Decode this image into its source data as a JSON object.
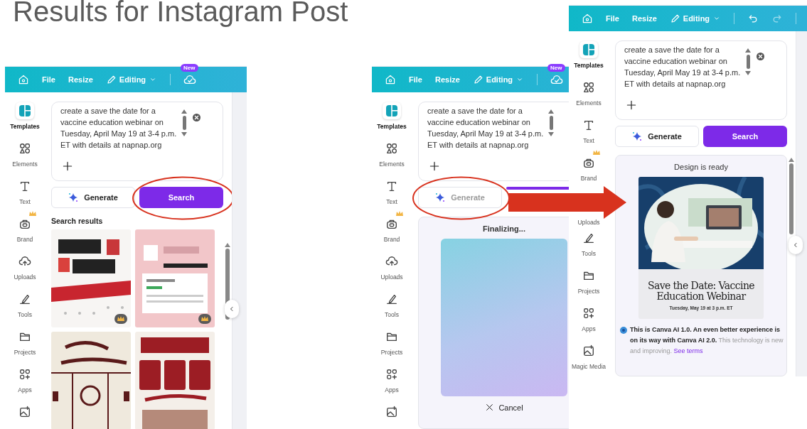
{
  "slide_title": "Results for Instagram Post",
  "panels": [
    {
      "kind": "search_results",
      "menu": {
        "file": "File",
        "resize": "Resize",
        "editing": "Editing"
      },
      "new_badge": "New",
      "sidebar": [
        {
          "label": "Templates",
          "selected": true
        },
        {
          "label": "Elements",
          "selected": false
        },
        {
          "label": "Text",
          "selected": false
        },
        {
          "label": "Brand",
          "selected": false
        },
        {
          "label": "Uploads",
          "selected": false
        },
        {
          "label": "Tools",
          "selected": false
        },
        {
          "label": "Projects",
          "selected": false
        },
        {
          "label": "Apps",
          "selected": false
        },
        {
          "selected": false
        }
      ],
      "prompt": "create a save the date for a vaccine education webinar on Tuesday, April May 19 at 3-4 p.m. ET with details at napnap.org",
      "generate": {
        "label": "Generate",
        "disabled": false
      },
      "search": {
        "label": "Search",
        "highlighted": true
      },
      "results_heading": "Search results"
    },
    {
      "kind": "generating",
      "menu": {
        "file": "File",
        "resize": "Resize",
        "editing": "Editing"
      },
      "new_badge": "New",
      "sidebar": [
        {
          "label": "Templates",
          "selected": true
        },
        {
          "label": "Elements",
          "selected": false
        },
        {
          "label": "Text",
          "selected": false
        },
        {
          "label": "Brand",
          "selected": false
        },
        {
          "label": "Uploads",
          "selected": false
        },
        {
          "label": "Tools",
          "selected": false
        },
        {
          "label": "Projects",
          "selected": false
        },
        {
          "label": "Apps",
          "selected": false
        },
        {
          "selected": false
        }
      ],
      "prompt": "create a save the date for a vaccine education webinar on Tuesday, April May 19 at 3-4 p.m. ET with details at napnap.org",
      "generate": {
        "label": "Generate",
        "disabled": true,
        "highlighted": true
      },
      "status": "Finalizing...",
      "cancel": "Cancel"
    },
    {
      "kind": "design_ready",
      "menu": {
        "file": "File",
        "resize": "Resize",
        "editing": "Editing"
      },
      "sidebar": [
        {
          "label": "Templates",
          "selected": true
        },
        {
          "label": "Elements",
          "selected": false
        },
        {
          "label": "Text",
          "selected": false
        },
        {
          "label": "Brand",
          "selected": false
        },
        {
          "label": "Uploads",
          "selected": false,
          "covered": true
        },
        {
          "label": "Tools",
          "selected": false
        },
        {
          "label": "Projects",
          "selected": false
        },
        {
          "label": "Apps",
          "selected": false
        },
        {
          "label": "Magic Media",
          "selected": false
        }
      ],
      "prompt": "create a save the date for a vaccine education webinar on Tuesday, April May 19 at 3-4 p.m. ET with details at napnap.org",
      "generate": {
        "label": "Generate",
        "disabled": false
      },
      "search": {
        "label": "Search"
      },
      "status": "Design is ready",
      "design": {
        "title": "Save the Date: Vaccine Education Webinar",
        "subtitle": "Tuesday, May 19 at 3 p.m. ET"
      },
      "notice": "**This is Canva AI 1.0. An even better experience is on its way with Canva AI 2.0.** This technology is new and improving.",
      "notice_link": "See terms"
    }
  ]
}
